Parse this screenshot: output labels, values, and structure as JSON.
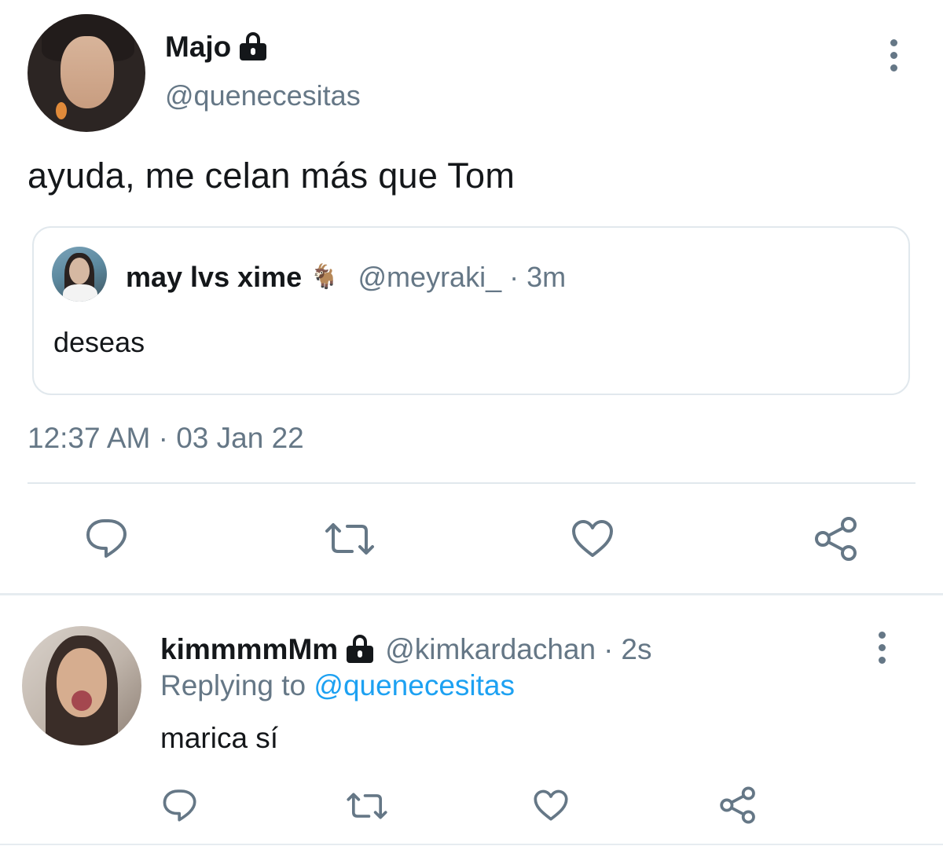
{
  "colors": {
    "text": "#14171a",
    "secondary": "#657786",
    "link": "#1da1f2",
    "border": "#e1e8ed",
    "icon": "#657786"
  },
  "main_tweet": {
    "display_name": "Majo",
    "protected_icon": "lock-icon",
    "handle": "@quenecesitas",
    "text": "ayuda, me celan más que Tom",
    "more_icon": "more-vertical-icon",
    "quoted": {
      "display_name": "may lvs xime",
      "emoji": "🐐",
      "handle": "@meyraki_",
      "separator": "·",
      "time": "3m",
      "text": "deseas"
    },
    "timestamp": "12:37 AM · 03 Jan 22",
    "actions": [
      "reply-icon",
      "retweet-icon",
      "like-icon",
      "share-icon"
    ]
  },
  "reply": {
    "display_name": "kimmmmMm",
    "protected_icon": "lock-icon",
    "handle": "@kimkardachan",
    "separator": "·",
    "time": "2s",
    "replying_prefix": "Replying to ",
    "replying_to": "@quenecesitas",
    "text": "marica sí",
    "more_icon": "more-vertical-icon",
    "actions": [
      "reply-icon",
      "retweet-icon",
      "like-icon",
      "share-icon"
    ]
  }
}
